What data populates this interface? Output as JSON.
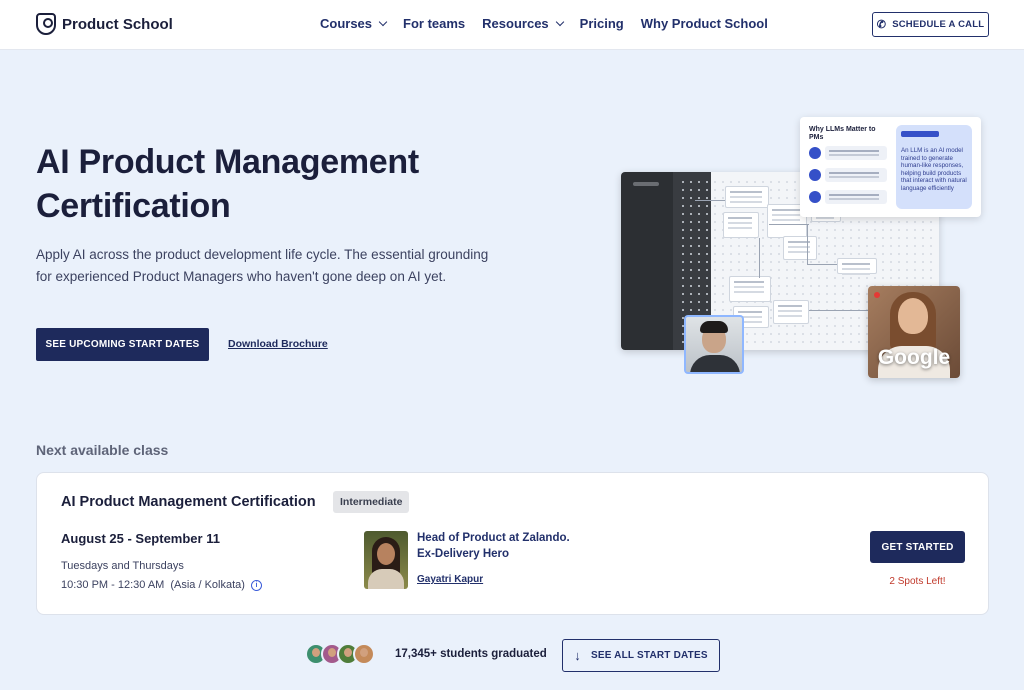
{
  "header": {
    "logo_text": "Product School",
    "nav": [
      {
        "label": "Courses",
        "dropdown": true
      },
      {
        "label": "For teams",
        "dropdown": false
      },
      {
        "label": "Resources",
        "dropdown": true
      },
      {
        "label": "Pricing",
        "dropdown": false
      },
      {
        "label": "Why Product School",
        "dropdown": false
      }
    ],
    "schedule_button": "SCHEDULE A CALL",
    "schedule_icon": "phone-icon"
  },
  "hero": {
    "title": "AI Product Management Certification",
    "description": "Apply AI across the product development life cycle. The essential grounding for experienced Product Managers who haven't gone deep on AI yet.",
    "primary_cta": "SEE UPCOMING START DATES",
    "secondary_cta": "Download Brochure",
    "visual": {
      "card_title": "Why LLMs Matter to PMs",
      "card_answer": "An LLM is an AI model trained to generate human-like responses, helping build products that interact with natural language efficiently",
      "video_label": "Google"
    }
  },
  "next_class": {
    "heading": "Next available class",
    "title": "AI Product Management Certification",
    "level": "Intermediate",
    "dates": "August 25 - September 11",
    "days": "Tuesdays and Thursdays",
    "time": "10:30 PM - 12:30 AM",
    "timezone": "(Asia / Kolkata)",
    "info_icon": "i",
    "instructor_role": "Head of Product at Zalando. Ex-Delivery Hero",
    "instructor_name": "Gayatri Kapur",
    "button": "GET STARTED",
    "spots": "2 Spots Left!"
  },
  "footer_row": {
    "students": "17,345+ students graduated",
    "see_all": "SEE ALL START DATES",
    "arrow_icon": "arrow-down-icon",
    "avatar_colors": [
      "#3d8f6e",
      "#a35a8c",
      "#4f7d3a",
      "#c48a5a"
    ]
  },
  "colors": {
    "brand_navy": "#1e2a5c",
    "background": "#eaf1fb",
    "spots_red": "#c0392b",
    "accent_blue": "#3550c8"
  }
}
